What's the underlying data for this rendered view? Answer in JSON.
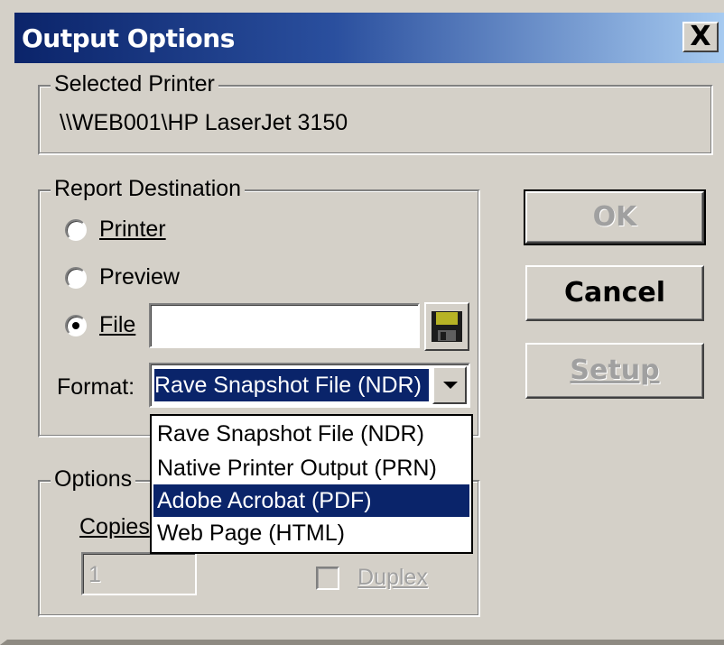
{
  "window": {
    "title": "Output Options",
    "close_label": "X"
  },
  "selected_printer": {
    "legend": "Selected Printer",
    "value": "\\\\WEB001\\HP LaserJet 3150"
  },
  "report_destination": {
    "legend": "Report Destination",
    "options": [
      {
        "label": "Printer",
        "selected": false
      },
      {
        "label": "Preview",
        "selected": false
      },
      {
        "label": "File",
        "selected": true
      }
    ],
    "file_value": "",
    "save_icon": "floppy-disk-icon",
    "format_label": "Format:",
    "format_selected": "Rave Snapshot File (NDR)",
    "format_options": [
      {
        "label": "Rave Snapshot File (NDR)",
        "highlighted": false
      },
      {
        "label": "Native Printer Output (PRN)",
        "highlighted": false
      },
      {
        "label": "Adobe Acrobat (PDF)",
        "highlighted": true
      },
      {
        "label": "Web Page (HTML)",
        "highlighted": false
      }
    ]
  },
  "options": {
    "legend": "Options",
    "copies_label": "Copies",
    "copies_value": "1",
    "duplex_label": "Duplex"
  },
  "buttons": {
    "ok": "OK",
    "cancel": "Cancel",
    "setup": "Setup"
  },
  "colors": {
    "title_start": "#0b246a",
    "title_end": "#a6caf0",
    "selection": "#0a246a",
    "face": "#d4d0c8"
  }
}
